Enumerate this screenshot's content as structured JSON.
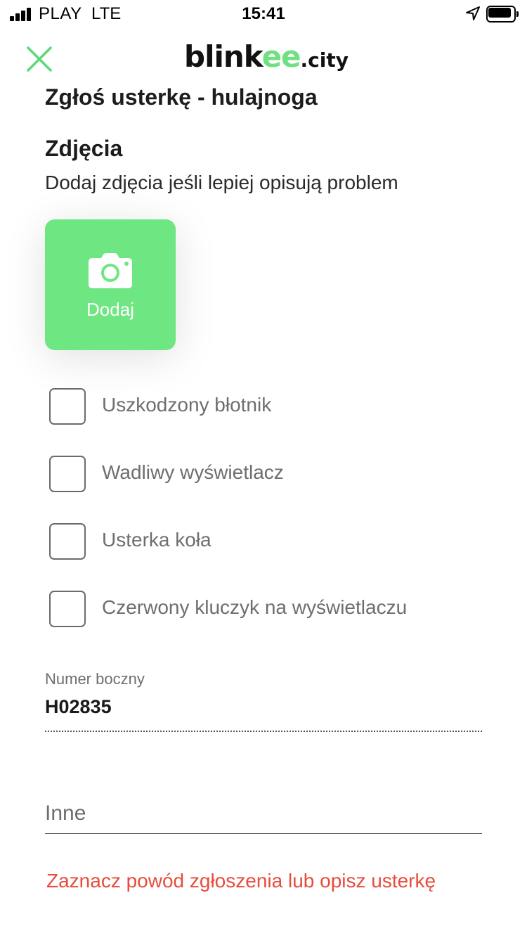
{
  "status_bar": {
    "carrier": "PLAY",
    "network": "LTE",
    "time": "15:41"
  },
  "header": {
    "logo_part1": "blink",
    "logo_part2": "ee",
    "logo_part3": ".city",
    "close_icon": "close-icon"
  },
  "page": {
    "title": "Zgłoś usterkę - hulajnoga"
  },
  "photos": {
    "title": "Zdjęcia",
    "description": "Dodaj zdjęcia jeśli lepiej opisują problem",
    "add_label": "Dodaj",
    "icon": "camera-icon"
  },
  "issues": [
    {
      "label": "Uszkodzony błotnik",
      "checked": false
    },
    {
      "label": "Wadliwy wyświetlacz",
      "checked": false
    },
    {
      "label": "Usterka koła",
      "checked": false
    },
    {
      "label": "Czerwony kluczyk na wyświetlaczu",
      "checked": false
    }
  ],
  "side_number": {
    "label": "Numer boczny",
    "value": "H02835"
  },
  "other": {
    "placeholder": "Inne",
    "value": ""
  },
  "error": "Zaznacz powód zgłoszenia lub opisz usterkę",
  "colors": {
    "accent": "#6ee682",
    "error": "#e74c3c",
    "close_icon": "#5cd978"
  }
}
